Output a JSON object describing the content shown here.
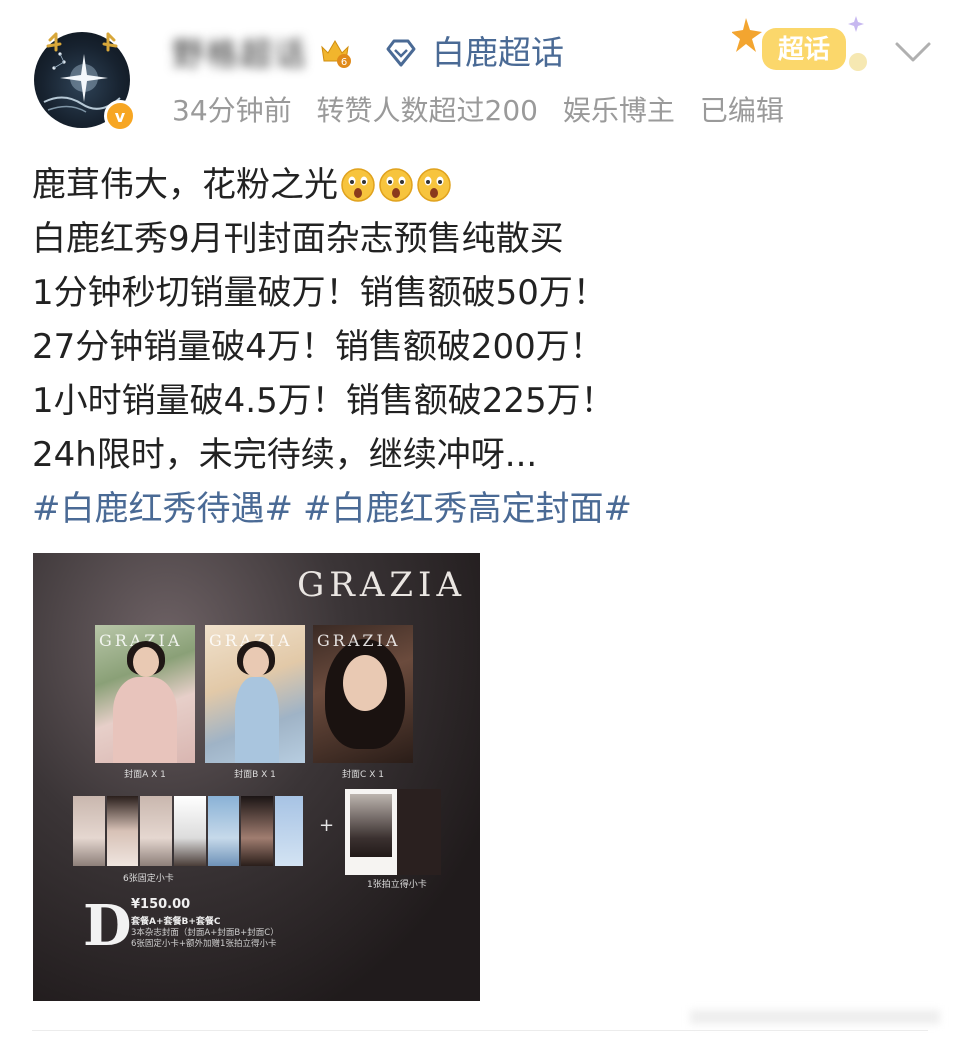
{
  "header": {
    "username": "野格超话",
    "supertopic": "白鹿超话",
    "meta": [
      "34分钟前",
      "转赞人数超过200",
      "娱乐博主",
      "已编辑"
    ],
    "chaohua_badge": "超话",
    "crown_level": "6"
  },
  "post": {
    "lines": [
      "鹿茸伟大，花粉之光",
      "白鹿红秀9月刊封面杂志预售纯散买",
      "1分钟秒切销量破万！销售额破50万！",
      "27分钟销量破4万！销售额破200万！",
      "1小时销量破4.5万！销售额破225万！",
      "24h限时，未完待续，继续冲呀..."
    ],
    "hashtags": [
      "#白鹿红秀待遇#",
      "#白鹿红秀高定封面#"
    ]
  },
  "image": {
    "brand": "GRAZIA",
    "covers": [
      {
        "mark": "GRAZIA",
        "label": "封面A X 1"
      },
      {
        "mark": "GRAZIA",
        "label": "封面B X 1"
      },
      {
        "mark": "GRAZIA",
        "label": "封面C X 1"
      }
    ],
    "cards_label": "6张固定小卡",
    "plus": "+",
    "polaroid_label": "1张拍立得小卡",
    "package_letter": "D",
    "price": "¥150.00",
    "desc": [
      "套餐A+套餐B+套餐C",
      "3本杂志封面（封面A+封面B+封面C）",
      "6张固定小卡+额外加赠1张拍立得小卡"
    ]
  },
  "colors": {
    "link": "#4a6a95",
    "meta": "#9a9a9a",
    "verified": "#f7a623"
  }
}
